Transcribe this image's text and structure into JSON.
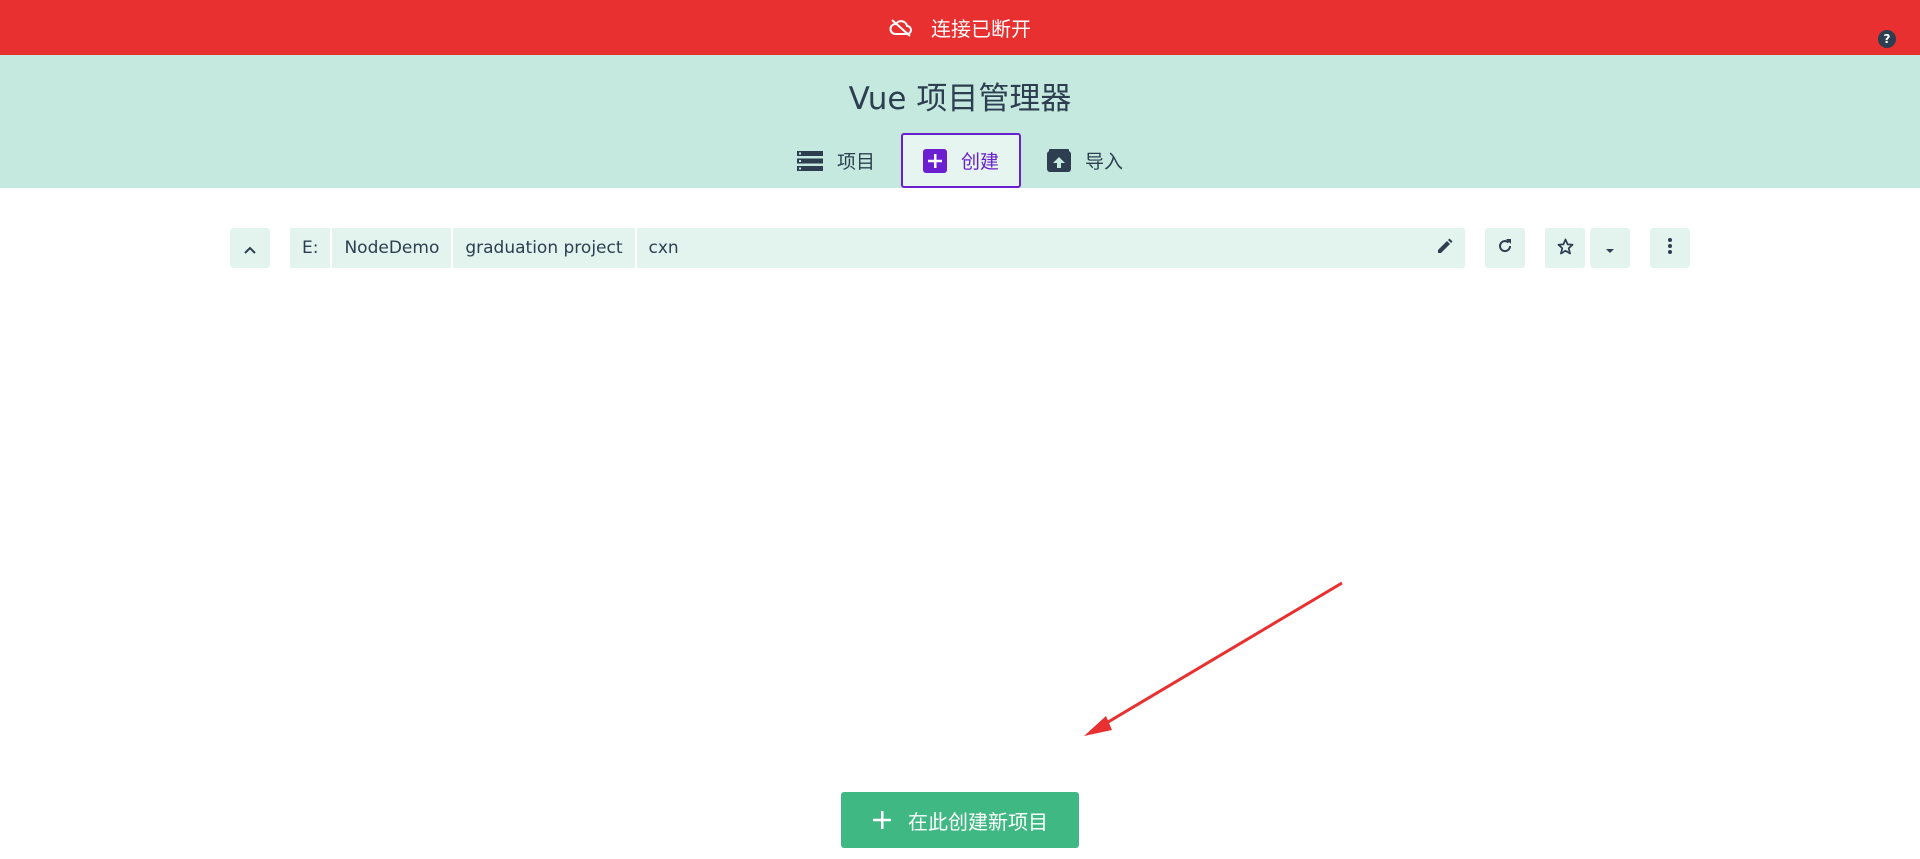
{
  "banner": {
    "text": "连接已断开",
    "icon": "cloud-off-icon",
    "color": "#e83030"
  },
  "help": {
    "label": "?",
    "icon": "help-icon"
  },
  "header": {
    "title": "Vue 项目管理器",
    "background": "#c5e9de",
    "tabs": [
      {
        "label": "项目",
        "icon": "list-icon",
        "selected": false
      },
      {
        "label": "创建",
        "icon": "add-box-icon",
        "selected": true
      },
      {
        "label": "导入",
        "icon": "import-icon",
        "selected": false
      }
    ]
  },
  "path": {
    "segments": [
      "E:",
      "NodeDemo",
      "graduation project",
      "cxn"
    ]
  },
  "toolbar": {
    "up_icon": "chevron-up-icon",
    "edit_icon": "pencil-icon",
    "refresh_icon": "refresh-icon",
    "favorite_icon": "star-outline-icon",
    "favorites_dropdown_icon": "caret-down-icon",
    "more_icon": "more-vertical-icon"
  },
  "create": {
    "label": "在此创建新项目",
    "icon": "plus-icon",
    "color": "#3fb883"
  },
  "annotation": {
    "type": "arrow",
    "color": "#e83030"
  }
}
